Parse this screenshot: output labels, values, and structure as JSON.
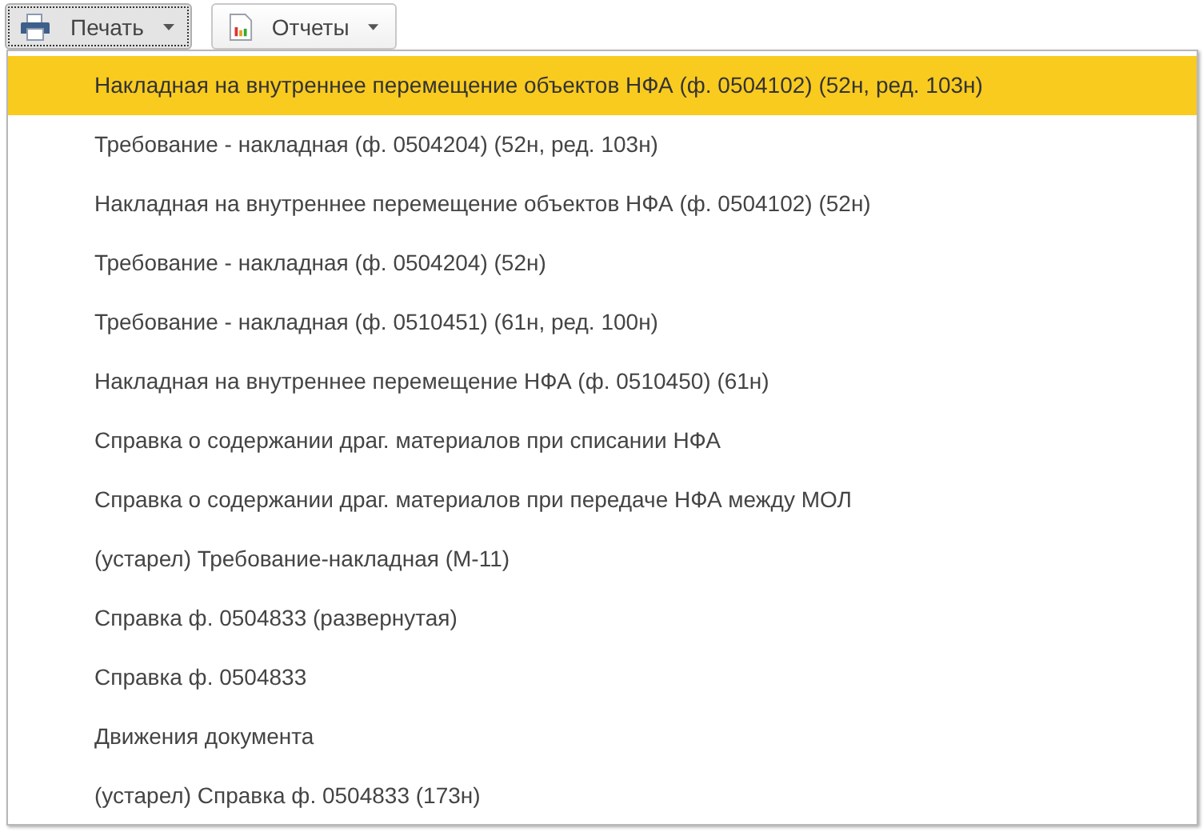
{
  "toolbar": [
    {
      "label": "Печать",
      "kind": "print",
      "pressed": true
    },
    {
      "label": "Отчеты",
      "kind": "reports",
      "pressed": false
    }
  ],
  "menu": {
    "items": [
      {
        "label": "Накладная на внутреннее перемещение объектов НФА (ф. 0504102) (52н, ред. 103н)",
        "selected": true
      },
      {
        "label": "Требование - накладная (ф. 0504204) (52н, ред. 103н)",
        "selected": false
      },
      {
        "label": "Накладная на внутреннее перемещение объектов НФА (ф. 0504102) (52н)",
        "selected": false
      },
      {
        "label": "Требование - накладная (ф. 0504204) (52н)",
        "selected": false
      },
      {
        "label": "Требование - накладная (ф. 0510451) (61н, ред. 100н)",
        "selected": false
      },
      {
        "label": "Накладная на внутреннее перемещение НФА (ф. 0510450) (61н)",
        "selected": false
      },
      {
        "label": "Справка о содержании драг. материалов при списании НФА",
        "selected": false
      },
      {
        "label": "Справка о содержании драг. материалов при передаче НФА между МОЛ",
        "selected": false
      },
      {
        "label": "(устарел) Требование-накладная (М-11)",
        "selected": false
      },
      {
        "label": "Справка ф. 0504833 (развернутая)",
        "selected": false
      },
      {
        "label": "Справка ф. 0504833",
        "selected": false
      },
      {
        "label": "Движения документа",
        "selected": false
      },
      {
        "label": "(устарел) Справка ф. 0504833 (173н)",
        "selected": false
      }
    ]
  }
}
